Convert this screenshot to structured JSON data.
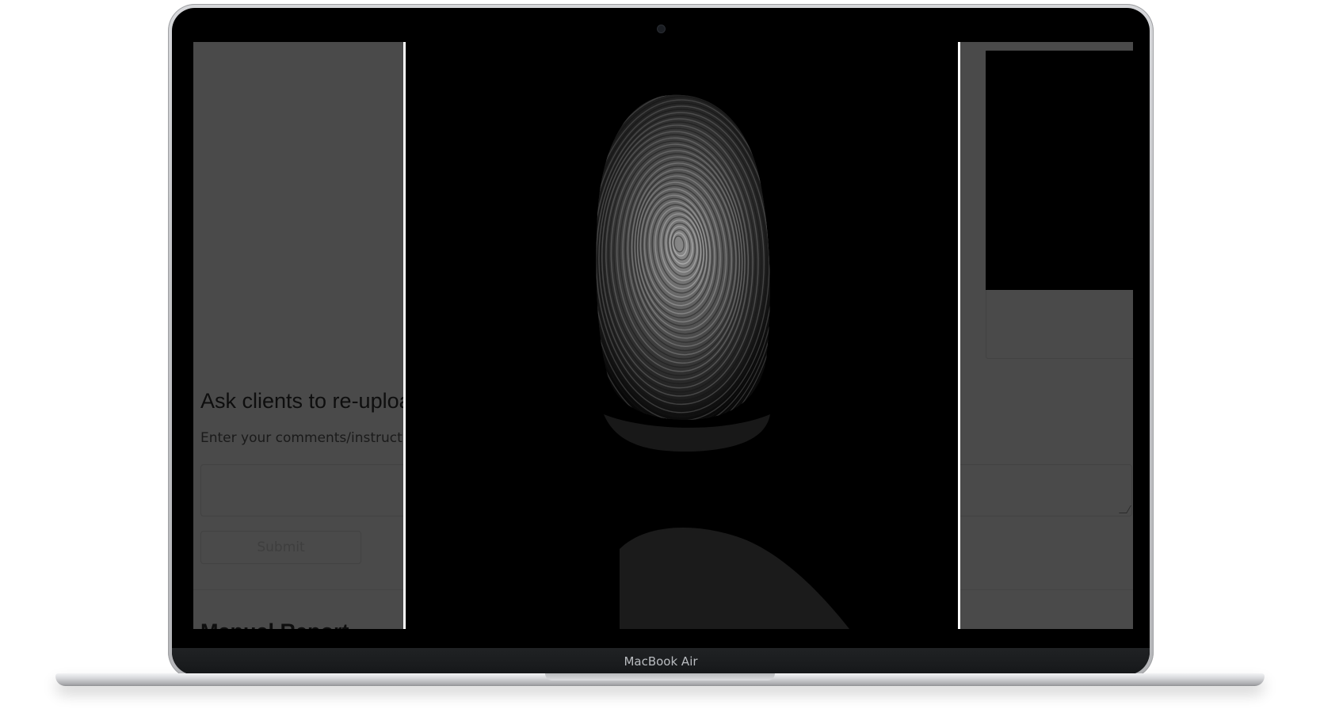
{
  "device": {
    "brand_label": "MacBook Air"
  },
  "page": {
    "reupload_section": {
      "title": "Ask clients to re-uploa",
      "instruction": "Enter your comments/instructi",
      "textarea_value": "",
      "submit_label": "Submit"
    },
    "manual_report": {
      "title": "Manual Report"
    }
  },
  "lightbox": {
    "image_icon": "fingerprint-icon",
    "overlay_opacity": 0.7
  },
  "colors": {
    "overlay_dim": "#4a4a4a",
    "lightbox_background": "#000000",
    "lightbox_border": "#ffffff"
  }
}
